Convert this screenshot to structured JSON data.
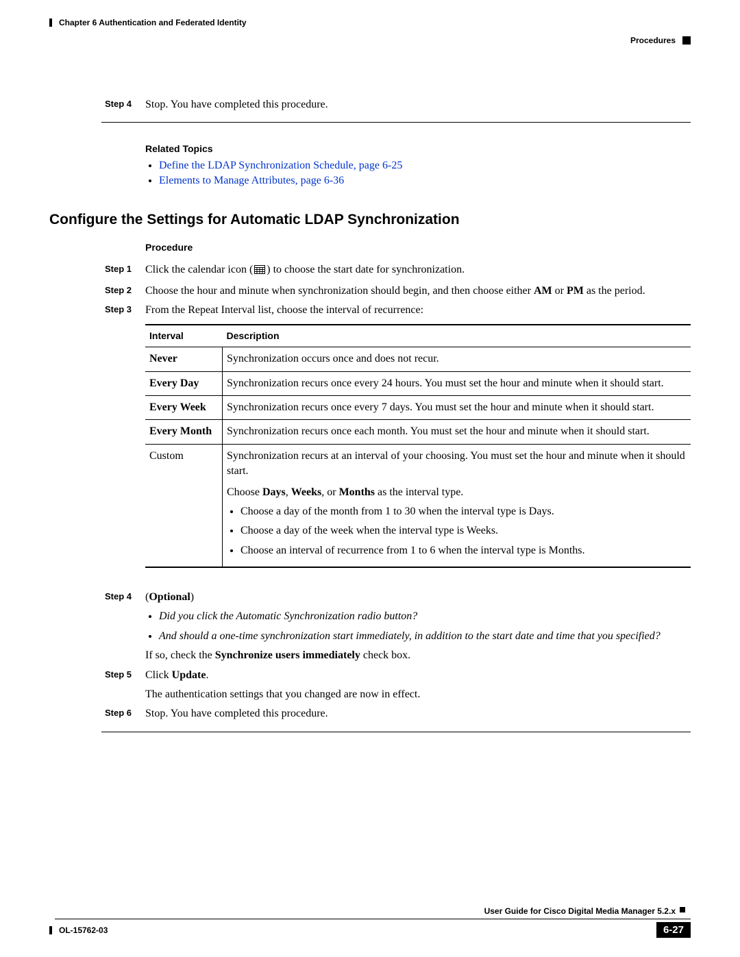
{
  "header": {
    "chapter": "Chapter 6    Authentication and Federated Identity",
    "section": "Procedures"
  },
  "top_step": {
    "label": "Step 4",
    "text": "Stop. You have completed this procedure."
  },
  "related": {
    "heading": "Related Topics",
    "links": [
      "Define the LDAP Synchronization Schedule, page 6-25",
      "Elements to Manage Attributes, page 6-36"
    ]
  },
  "section_title": "Configure the Settings for Automatic LDAP Synchronization",
  "procedure_heading": "Procedure",
  "steps": {
    "s1_label": "Step 1",
    "s1_a": "Click the calendar icon (",
    "s1_b": ") to choose the start date for synchronization.",
    "s2_label": "Step 2",
    "s2_a": "Choose the hour and minute when synchronization should begin, and then choose either ",
    "s2_am": "AM",
    "s2_or": " or ",
    "s2_pm": "PM",
    "s2_b": " as the period.",
    "s3_label": "Step 3",
    "s3_text": "From the Repeat Interval list, choose the interval of recurrence:",
    "s4_label": "Step 4",
    "s4_optional": "Optional",
    "s4_q1": "Did you click the Automatic Synchronization radio button?",
    "s4_q2": "And should a one-time synchronization start immediately, in addition to the start date and time that you specified?",
    "s4_ifso_a": "If so, check the ",
    "s4_ifso_b": "Synchronize users immediately",
    "s4_ifso_c": " check box.",
    "s5_label": "Step 5",
    "s5_a": "Click ",
    "s5_b": "Update",
    "s5_c": ".",
    "s5_after": "The authentication settings that you changed are now in effect.",
    "s6_label": "Step 6",
    "s6_text": "Stop. You have completed this procedure."
  },
  "table": {
    "h1": "Interval",
    "h2": "Description",
    "r1c1": "Never",
    "r1c2": "Synchronization occurs once and does not recur.",
    "r2c1": "Every Day",
    "r2c2": "Synchronization recurs once every 24 hours. You must set the hour and minute when it should start.",
    "r3c1": "Every Week",
    "r3c2": "Synchronization recurs once every 7 days. You must set the hour and minute when it should start.",
    "r4c1": "Every Month",
    "r4c2": "Synchronization recurs once each month. You must set the hour and minute when it should start.",
    "r5c1": "Custom",
    "r5c2_p1": "Synchronization recurs at an interval of your choosing. You must set the hour and minute when it should start.",
    "r5c2_p2_a": "Choose ",
    "r5c2_p2_days": "Days",
    "r5c2_p2_c1": ", ",
    "r5c2_p2_weeks": "Weeks",
    "r5c2_p2_c2": ", or ",
    "r5c2_p2_months": "Months",
    "r5c2_p2_b": " as the interval type.",
    "r5c2_li1": "Choose a day of the month from 1 to 30 when the interval type is Days.",
    "r5c2_li2": "Choose a day of the week when the interval type is Weeks.",
    "r5c2_li3": "Choose an interval of recurrence from 1 to 6 when the interval type is Months."
  },
  "footer": {
    "guide": "User Guide for Cisco Digital Media Manager 5.2.x",
    "doc": "OL-15762-03",
    "page": "6-27"
  }
}
